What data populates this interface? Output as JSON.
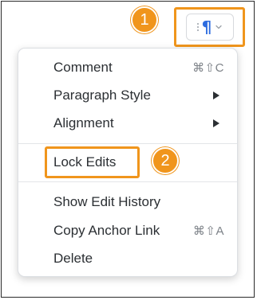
{
  "toolbar": {
    "paragraph_button": {
      "glyph": "¶",
      "icon": "paragraph-icon",
      "chevron_icon": "chevron-down-icon",
      "drag_icon": "drag-handle-icon"
    }
  },
  "callouts": {
    "badge_1": "1",
    "badge_2": "2",
    "color": "#f0951c"
  },
  "menu": {
    "items": [
      {
        "label": "Comment",
        "shortcut": "⌘⇧C"
      },
      {
        "label": "Paragraph Style",
        "submenu": true
      },
      {
        "label": "Alignment",
        "submenu": true
      },
      {
        "label": "Lock Edits"
      },
      {
        "label": "Show Edit History"
      },
      {
        "label": "Copy Anchor Link",
        "shortcut": "⌘⇧A"
      },
      {
        "label": "Delete"
      }
    ]
  },
  "colors": {
    "accent_blue": "#2d6cdf",
    "highlight_orange": "#f0951c",
    "text": "#2b2f33",
    "shortcut": "#7d8288"
  }
}
